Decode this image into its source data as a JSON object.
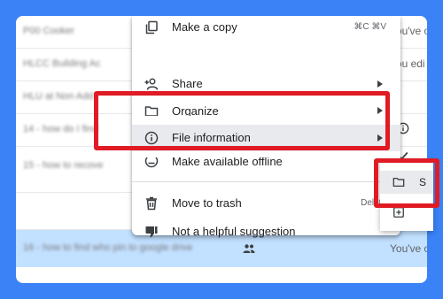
{
  "file_list": {
    "rows": [
      {
        "name": "P00 Cooker",
        "right_text": "You've o",
        "selected": false
      },
      {
        "name": "HLCC Building Ac",
        "right_text": "You edi",
        "selected": false
      },
      {
        "name": "HLU at Non Add",
        "right_text": "",
        "selected": false
      },
      {
        "name": "14 - how do I find",
        "right_text": "",
        "selected": false
      },
      {
        "name": "15 - how to recove",
        "right_text": "",
        "selected": false
      },
      {
        "name": "",
        "right_text": "",
        "selected": false
      },
      {
        "name": "16 - how to find who pin to google drive",
        "right_text": "You've o",
        "selected": true
      }
    ]
  },
  "context_menu": {
    "items": [
      {
        "label": "Make a copy",
        "shortcut": "⌘C ⌘V",
        "icon": "copy-icon",
        "has_submenu": false
      },
      {
        "label": "Share",
        "shortcut": "",
        "icon": "person-add-icon",
        "has_submenu": true
      },
      {
        "label": "Organize",
        "shortcut": "",
        "icon": "folder-icon",
        "has_submenu": true
      },
      {
        "label": "File information",
        "shortcut": "",
        "icon": "info-icon",
        "has_submenu": true,
        "highlighted": true
      },
      {
        "label": "Make available offline",
        "shortcut": "",
        "icon": "offline-icon",
        "has_submenu": false
      },
      {
        "label": "Move to trash",
        "shortcut": "Delete",
        "icon": "trash-icon",
        "has_submenu": false
      },
      {
        "label": "Not a helpful suggestion",
        "shortcut": "",
        "icon": "thumbs-down-icon",
        "has_submenu": false
      }
    ]
  },
  "submenu": {
    "items": [
      {
        "label": "S",
        "icon": "folder-icon",
        "highlighted": true
      },
      {
        "label": "",
        "icon": "drive-icon",
        "highlighted": false
      }
    ]
  },
  "colors": {
    "page_background": "#3b82f6",
    "selected_row": "#c2e0ff",
    "highlight_annotation": "#e01b24",
    "menu_hover": "#e8eaed"
  }
}
